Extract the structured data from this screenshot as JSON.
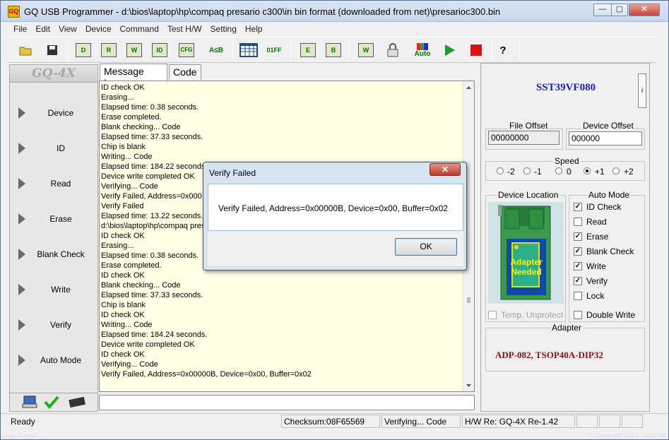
{
  "window": {
    "title": "GQ USB Programmer - d:\\bios\\laptop\\hp\\compaq presario c300\\in bin format (downloaded from net)\\presarioc300.bin",
    "app_icon_text": "GQ",
    "min_glyph": "—",
    "max_glyph": "▢",
    "close_glyph": "✕"
  },
  "menu": [
    "File",
    "Edit",
    "View",
    "Device",
    "Command",
    "Test H/W",
    "Setting",
    "Help"
  ],
  "toolbar": {
    "read_label": "R",
    "write_label": "W",
    "id_label": "ID",
    "cfg_label": "CFG",
    "ab_label": "A≤B",
    "hex_label": "01FF",
    "erase_label": "E",
    "blank_label": "B",
    "auto_label": "Auto",
    "help_label": "?"
  },
  "sidebar": {
    "logo": "GQ-4X",
    "items": [
      "Device",
      "ID",
      "Read",
      "Erase",
      "Blank Check",
      "Write",
      "Verify",
      "Auto Mode"
    ]
  },
  "tabs": [
    "Message Log",
    "Code"
  ],
  "log": [
    "ID check OK",
    "Erasing...",
    "Elapsed time: 0.38 seconds.",
    "Erase completed.",
    "Blank checking... Code",
    "Elapsed time: 37.33 seconds.",
    "Chip is blank",
    "Writing... Code",
    "Elapsed time: 184.22 seconds.",
    "Device write completed OK",
    "Verifying... Code",
    "Verify Failed, Address=0x000",
    "Verify Failed",
    "Elapsed time: 13.22 seconds.",
    "d:\\bios\\laptop\\hp\\compaq presa",
    "ID check OK",
    "Erasing...",
    "Elapsed time: 0.38 seconds.",
    "Erase completed.",
    "ID check OK",
    "Blank checking... Code",
    "Elapsed time: 37.33 seconds.",
    "Chip is blank",
    "ID check OK",
    "Writing... Code",
    "Elapsed time: 184.24 seconds.",
    "Device write completed OK",
    "ID check OK",
    "Verifying... Code",
    "Verify Failed, Address=0x00000B, Device=0x00, Buffer=0x02"
  ],
  "device": {
    "name": "SST39VF080",
    "info_btn": "i",
    "file_offset_label": "File Offset",
    "file_offset": "00000000",
    "device_offset_label": "Device Offset",
    "device_offset": "000000",
    "speed_label": "Speed",
    "speed_options": [
      "-2",
      "-1",
      "0",
      "+1",
      "+2"
    ],
    "speed_selected": "+1",
    "device_location_label": "Device Location",
    "adapter_needed": "Adapter Needed",
    "temp_unprotect": "Temp. Unprotect",
    "auto_mode_label": "Auto Mode",
    "auto_mode": [
      {
        "label": "ID Check",
        "checked": true
      },
      {
        "label": "Read",
        "checked": false
      },
      {
        "label": "Erase",
        "checked": true
      },
      {
        "label": "Blank Check",
        "checked": true
      },
      {
        "label": "Write",
        "checked": true
      },
      {
        "label": "Verify",
        "checked": true
      },
      {
        "label": "Lock",
        "checked": false
      }
    ],
    "double_write": "Double Write",
    "adapter_label": "Adapter",
    "adapter_name": "ADP-082, TSOP40A-DIP32"
  },
  "status": {
    "ready": "Ready",
    "checksum": "Checksum:08F65569",
    "task": "Verifying... Code",
    "hw": "H/W Re: GQ-4X Re-1.42"
  },
  "dialog": {
    "title": "Verify Failed",
    "close_glyph": "✕",
    "message": "Verify Failed, Address=0x00000B, Device=0x00, Buffer=0x02",
    "ok": "OK"
  },
  "desktop": {
    "left_text": "uage Føyez",
    "right_text": "© Copyright 2003 - 2008 Mi"
  },
  "colors": {
    "device_name": "#1a1ad0",
    "adapter_name": "#8a1010",
    "log_bg": "#ffffe6"
  }
}
